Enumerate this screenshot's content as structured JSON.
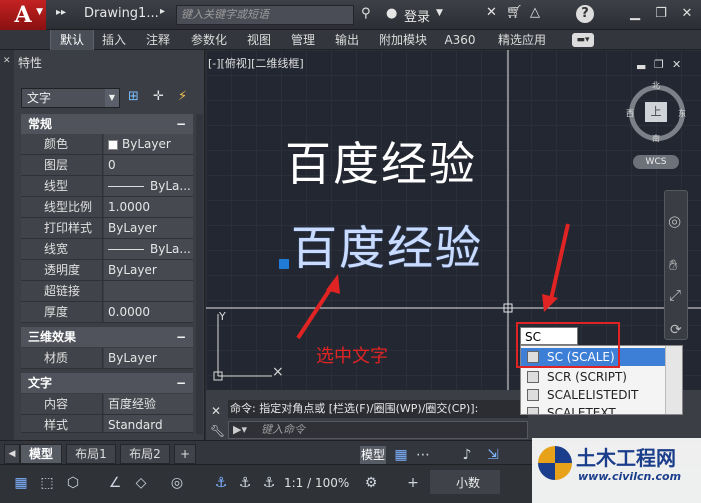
{
  "window": {
    "app_letter": "A",
    "file_title": "Drawing1...",
    "search_placeholder": "键入关键字或短语",
    "login_label": "登录",
    "help_label": "?"
  },
  "ribbon": {
    "tabs": [
      "默认",
      "插入",
      "注释",
      "参数化",
      "视图",
      "管理",
      "输出",
      "附加模块",
      "A360",
      "精选应用"
    ],
    "active_index": 0
  },
  "properties": {
    "title": "特性",
    "type_value": "文字",
    "sections": {
      "general": "常规",
      "three_d": "三维效果",
      "text": "文字"
    },
    "general_rows": [
      {
        "key": "颜色",
        "value": "ByLayer"
      },
      {
        "key": "图层",
        "value": "0"
      },
      {
        "key": "线型",
        "value": "ByLa..."
      },
      {
        "key": "线型比例",
        "value": "1.0000"
      },
      {
        "key": "打印样式",
        "value": "ByLayer"
      },
      {
        "key": "线宽",
        "value": "ByLa..."
      },
      {
        "key": "透明度",
        "value": "ByLayer"
      },
      {
        "key": "超链接",
        "value": ""
      },
      {
        "key": "厚度",
        "value": "0.0000"
      }
    ],
    "three_d_rows": [
      {
        "key": "材质",
        "value": "ByLayer"
      }
    ],
    "text_rows": [
      {
        "key": "内容",
        "value": "百度经验"
      },
      {
        "key": "样式",
        "value": "Standard"
      }
    ]
  },
  "canvas": {
    "viewport_label": "[-][俯视][二维线框]",
    "text_upper": "百度经验",
    "text_lower": "百度经验",
    "annotation": "选中文字",
    "viewcube": {
      "top": "上",
      "north": "北",
      "south": "南",
      "east": "东",
      "west": "西",
      "wcs": "WCS"
    }
  },
  "command": {
    "history": "命令: 指定对角点或 [栏选(F)/圈围(WP)/圈交(CP)]:",
    "placeholder": "键入命令",
    "typed": "SC",
    "suggestions": [
      "SC (SCALE)",
      "SCR (SCRIPT)",
      "SCALELISTEDIT",
      "SCALETEXT"
    ],
    "selected_index": 0
  },
  "layout_tabs": [
    "模型",
    "布局1",
    "布局2"
  ],
  "layout_add": "+",
  "status": {
    "model_label": "模型",
    "scale": "1:1 / 100%",
    "annotation_scale": "小数"
  },
  "watermark": {
    "title": "土木工程网",
    "url": "www.civilcn.com"
  },
  "colors": {
    "accent_red": "#e02424",
    "selection_blue": "#3d7ed6",
    "grip_blue": "#1f7bd6"
  }
}
